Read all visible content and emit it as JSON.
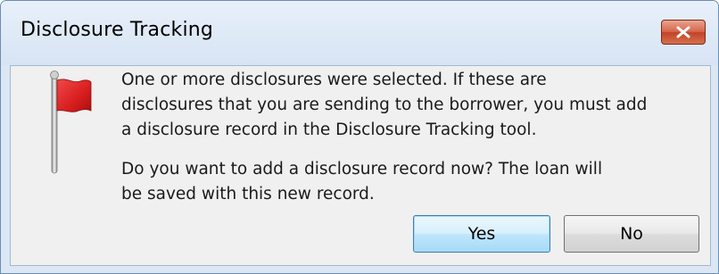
{
  "dialog": {
    "title": "Disclosure Tracking",
    "message_lines": [
      "One or more disclosures were selected. If these are",
      "disclosures that you are sending to the borrower, you must add",
      "a disclosure record in the Disclosure Tracking tool."
    ],
    "question_lines": [
      "Do you want to add a disclosure record now? The loan will",
      "be saved with this new record."
    ],
    "icon": "red-flag-icon",
    "close_icon": "close-icon",
    "buttons": {
      "yes_label": "Yes",
      "no_label": "No"
    }
  },
  "colors": {
    "close_button": "#c94a2f",
    "flag": "#d81e1e",
    "default_button_border": "#3c7fb1"
  }
}
